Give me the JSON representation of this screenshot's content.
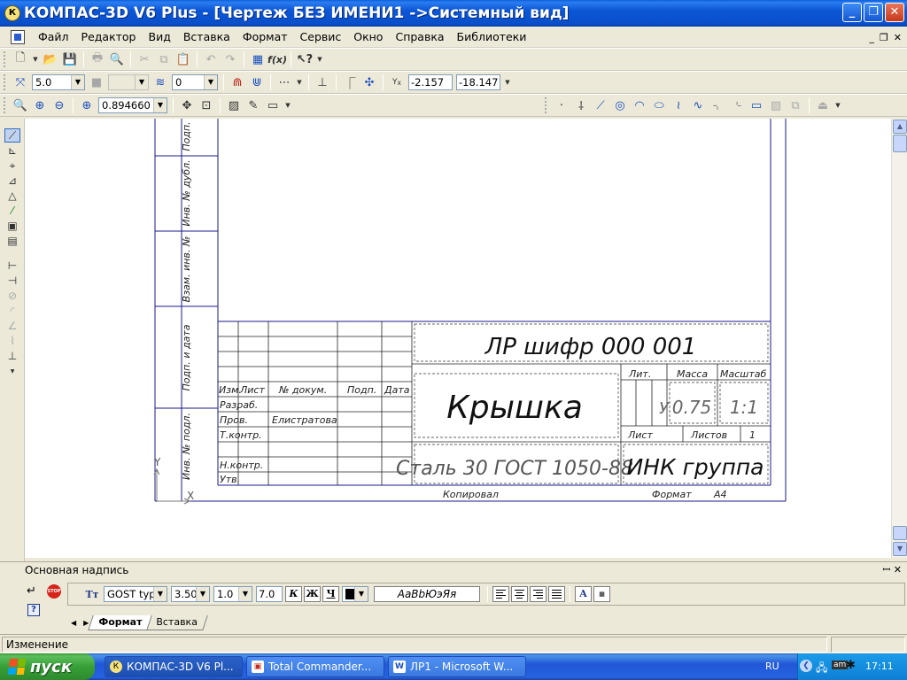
{
  "window": {
    "title": "КОМПАС-3D V6 Plus - [Чертеж БЕЗ ИМЕНИ1 ->Системный вид]",
    "app_icon_glyph": "К"
  },
  "menu": {
    "items": [
      "Файл",
      "Редактор",
      "Вид",
      "Вставка",
      "Формат",
      "Сервис",
      "Окно",
      "Справка",
      "Библиотеки"
    ]
  },
  "toolbar2": {
    "step_value": "5.0",
    "layer_value": "0",
    "coord_x": "-2.157",
    "coord_y": "-18.147"
  },
  "toolbar3": {
    "zoom_value": "0.894660"
  },
  "drawing": {
    "side_labels": [
      "Подп.",
      "Инв. № дубл.",
      "Взам. инв. №",
      "Подп. и дата",
      "Инв. № подл."
    ],
    "doc_code": "ЛР шифр 000 001",
    "part_name": "Крышка",
    "material": "Сталь 30 ГОСТ 1050-88",
    "org": "ИНК группа",
    "col_headers": {
      "izm": "Изм.",
      "list": "Лист",
      "doc_no": "№ докум.",
      "sign": "Подп.",
      "date": "Дата"
    },
    "roles": {
      "razrab": "Разраб.",
      "prov": "Пров.",
      "tkontr": "Т.контр.",
      "nkontr": "Н.контр.",
      "utv": "Утв."
    },
    "checker_name": "Елистратова",
    "labels": {
      "lit": "Лит.",
      "massa": "Масса",
      "masshtab": "Масштаб",
      "list": "Лист",
      "listov": "Листов"
    },
    "values": {
      "lit": "У",
      "massa": "0.75",
      "masshtab": "1:1",
      "listov": "1"
    },
    "footer": {
      "copied": "Копировал",
      "format": "Формат",
      "format_value": "A4"
    },
    "axis_y": "Y",
    "axis_x": "X"
  },
  "panel": {
    "title": "Основная надпись",
    "font_name": "GOST type",
    "font_size": "3.50",
    "line_factor": "1.0",
    "width_value": "7.0",
    "bold_label": "К",
    "italic_label": "Ж",
    "underline_label": "Ч",
    "sample_text": "АаВbЮэЯя",
    "tabs": [
      "Формат",
      "Вставка"
    ]
  },
  "status": {
    "text": "Изменение"
  },
  "taskbar": {
    "start_label": "пуск",
    "tasks": [
      "КОМПАС-3D V6 Pl...",
      "Total Commander...",
      "ЛР1 - Microsoft W..."
    ],
    "lang": "RU",
    "clock": "17:11"
  },
  "colors": {
    "frame": "#1a1a8c",
    "title_blue": "#0a4fc9",
    "start_green": "#38a038"
  }
}
